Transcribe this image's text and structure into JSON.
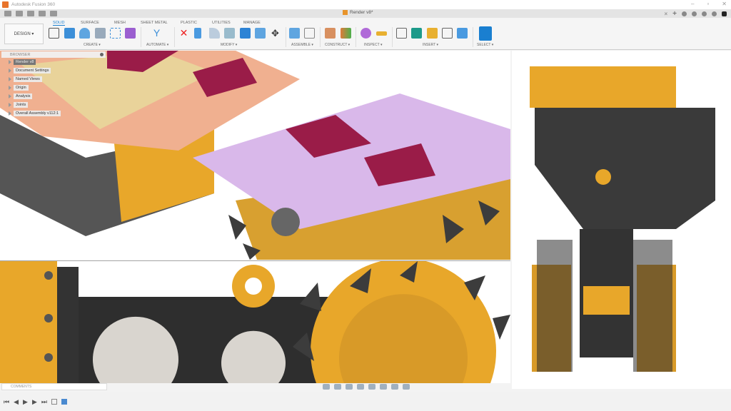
{
  "app_title": "Autodesk Fusion 360",
  "document_tab": "Render v8*",
  "workspace": "DESIGN ▾",
  "tabs": [
    "SOLID",
    "SURFACE",
    "MESH",
    "SHEET METAL",
    "PLASTIC",
    "UTILITIES",
    "MANAGE"
  ],
  "groups": [
    "CREATE ▾",
    "AUTOMATE ▾",
    "MODIFY ▾",
    "ASSEMBLE ▾",
    "CONSTRUCT ▾",
    "INSPECT ▾",
    "INSERT ▾",
    "SELECT ▾"
  ],
  "browser": {
    "title": "BROWSER",
    "root": "Render v8",
    "items": [
      "Document Settings",
      "Named Views",
      "Origin",
      "Analysis",
      "Joints",
      "Overall Assembly v112:1"
    ]
  },
  "comments": "COMMENTS",
  "colors": {
    "accent": "#1a7fd0",
    "yellow": "#e8a72a",
    "dark": "#3a3a3a"
  }
}
